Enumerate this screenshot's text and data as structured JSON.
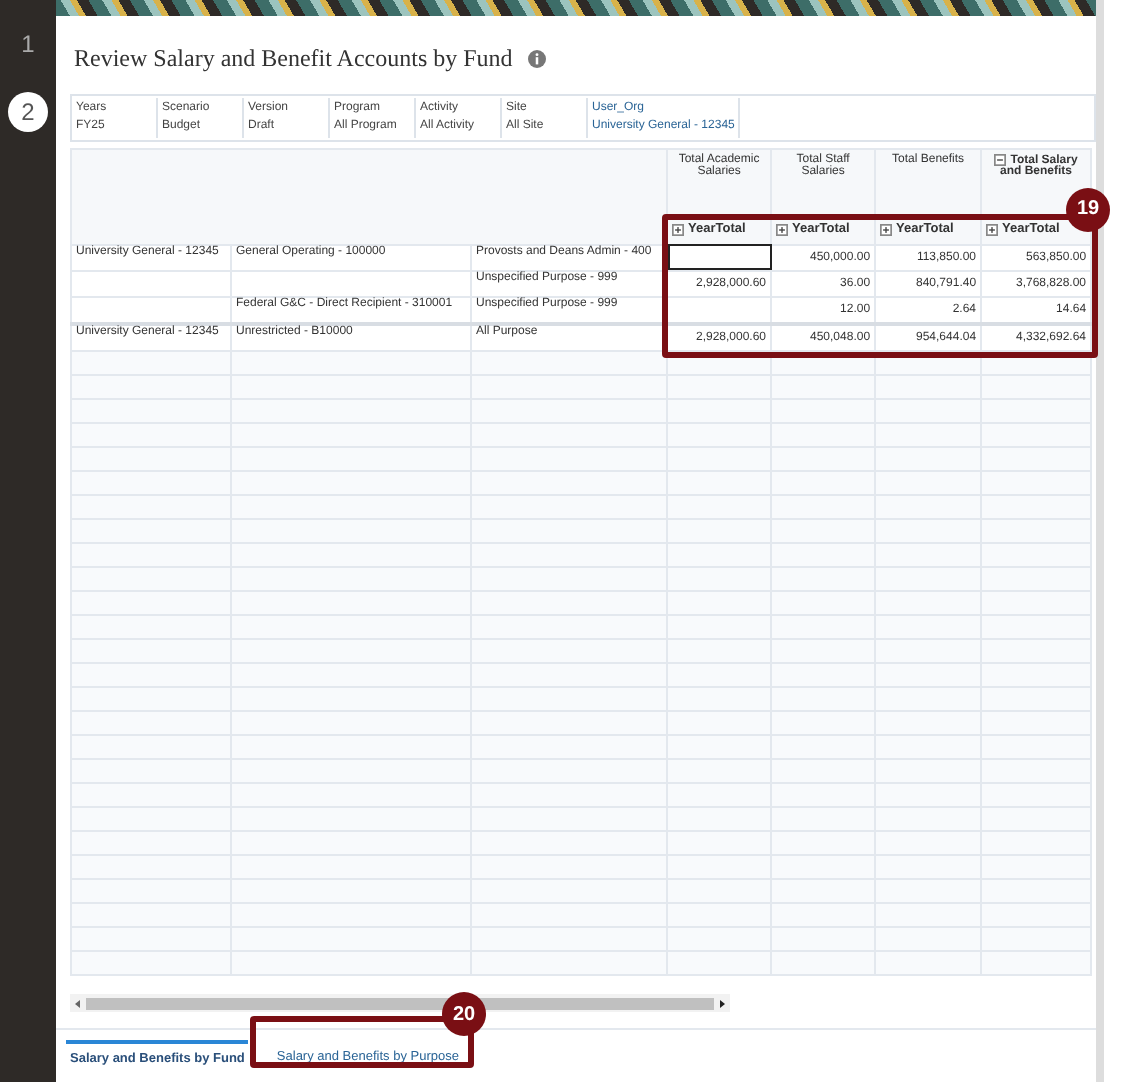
{
  "steps": [
    {
      "label": "1",
      "current": false
    },
    {
      "label": "2",
      "current": true
    }
  ],
  "title": "Review Salary and Benefit Accounts by Fund",
  "pov": [
    {
      "label": "Years",
      "value": "FY25",
      "kind": "plain"
    },
    {
      "label": "Scenario",
      "value": "Budget",
      "kind": "plain"
    },
    {
      "label": "Version",
      "value": "Draft",
      "kind": "plain"
    },
    {
      "label": "Program",
      "value": "All Program",
      "kind": "plain"
    },
    {
      "label": "Activity",
      "value": "All Activity",
      "kind": "plain"
    },
    {
      "label": "Site",
      "value": "All Site",
      "kind": "plain"
    },
    {
      "label": "User_Org",
      "value": "University General - 12345",
      "kind": "link"
    }
  ],
  "columns": [
    {
      "label": "Total Academic Salaries",
      "sub": "YearTotal",
      "collapsible": false
    },
    {
      "label": "Total Staff Salaries",
      "sub": "YearTotal",
      "collapsible": false
    },
    {
      "label": "Total Benefits",
      "sub": "YearTotal",
      "collapsible": false
    },
    {
      "label": "Total Salary and Benefits",
      "sub": "YearTotal",
      "collapsible": true
    }
  ],
  "rows": [
    {
      "org": "University General - 12345",
      "fund": "General Operating - 100000",
      "purpose": "Provosts and Deans Admin - 400",
      "values": [
        {
          "selected": true
        },
        {
          "text": "450,000.00",
          "selected": false
        },
        {
          "text": "113,850.00",
          "selected": false
        },
        {
          "text": "563,850.00",
          "selected": false
        }
      ]
    },
    {
      "purpose": "Unspecified Purpose - 999",
      "values": [
        {
          "text": "2,928,000.60",
          "selected": false
        },
        {
          "text": "36.00",
          "selected": false
        },
        {
          "text": "840,791.40",
          "selected": false
        },
        {
          "text": "3,768,828.00",
          "selected": false
        }
      ]
    },
    {
      "fund": "Federal G&C - Direct Recipient - 310001",
      "purpose": "Unspecified Purpose - 999",
      "values": [
        {
          "selected": false
        },
        {
          "text": "12.00",
          "selected": false
        },
        {
          "text": "2.64",
          "selected": false
        },
        {
          "text": "14.64",
          "selected": false
        }
      ]
    },
    {
      "org": "University General - 12345",
      "fund": "Unrestricted - B10000",
      "purpose": "All Purpose",
      "values": [
        {
          "text": "2,928,000.60",
          "selected": false
        },
        {
          "text": "450,048.00",
          "selected": false
        },
        {
          "text": "954,644.04",
          "selected": false
        },
        {
          "text": "4,332,692.64",
          "selected": false
        }
      ]
    }
  ],
  "tabs": [
    {
      "label": "Salary and Benefits by Fund",
      "selected": true
    },
    {
      "label": "Salary and Benefits by Purpose",
      "selected": false
    }
  ],
  "callouts": [
    {
      "label": "19"
    },
    {
      "label": "20"
    }
  ]
}
